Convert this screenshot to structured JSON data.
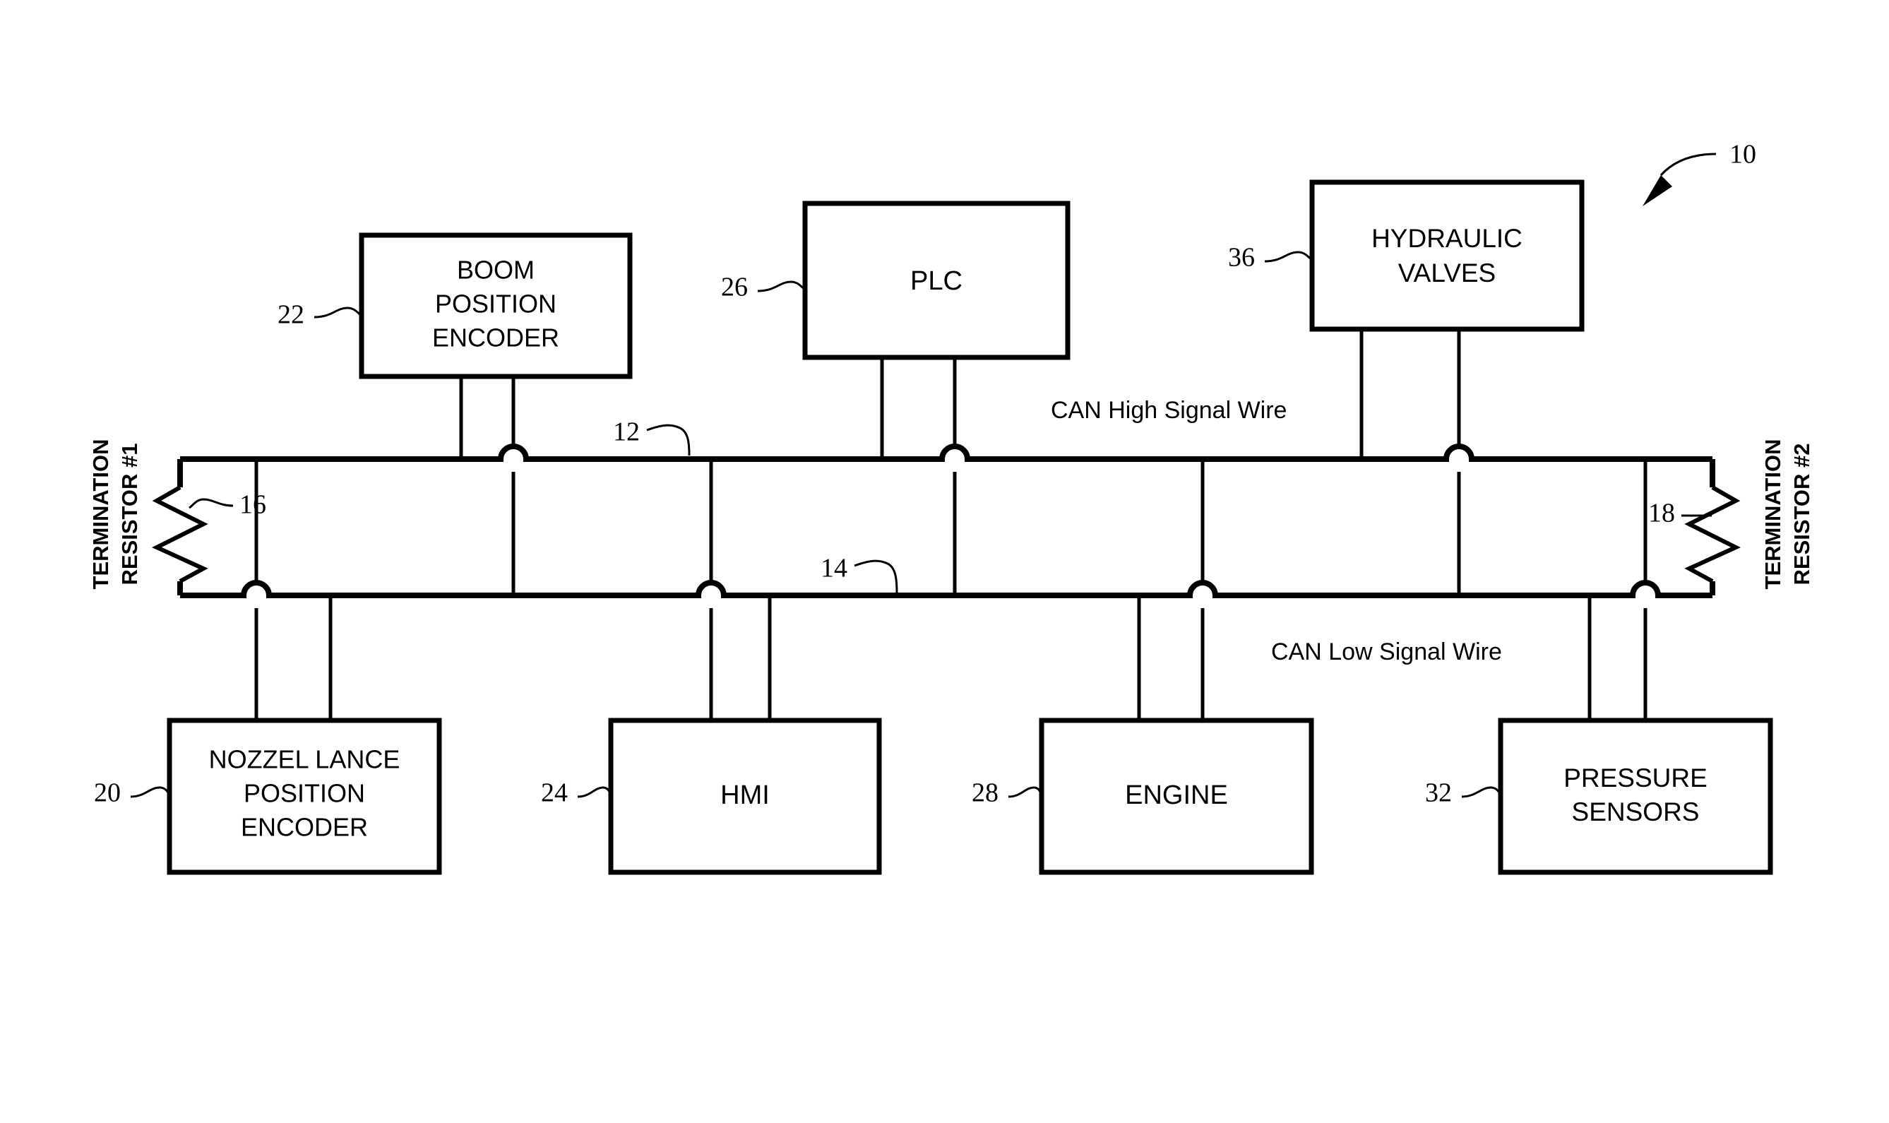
{
  "figure": {
    "ref_number": "10",
    "bus_lines": {
      "high": {
        "ref": "12",
        "label": "CAN High Signal Wire"
      },
      "low": {
        "ref": "14",
        "label": "CAN Low Signal Wire"
      }
    },
    "terminations": [
      {
        "ref": "16",
        "label_line1": "TERMINATION",
        "label_line2": "RESISTOR #1",
        "side": "left"
      },
      {
        "ref": "18",
        "label_line1": "TERMINATION",
        "label_line2": "RESISTOR #2",
        "side": "right"
      }
    ],
    "top_nodes": [
      {
        "ref": "22",
        "lines": [
          "BOOM",
          "POSITION",
          "ENCODER"
        ]
      },
      {
        "ref": "26",
        "lines": [
          "PLC"
        ]
      },
      {
        "ref": "36",
        "lines": [
          "HYDRAULIC",
          "VALVES"
        ]
      }
    ],
    "bottom_nodes": [
      {
        "ref": "20",
        "lines": [
          "NOZZEL LANCE",
          "POSITION",
          "ENCODER"
        ]
      },
      {
        "ref": "24",
        "lines": [
          "HMI"
        ]
      },
      {
        "ref": "28",
        "lines": [
          "ENGINE"
        ]
      },
      {
        "ref": "32",
        "lines": [
          "PRESSURE",
          "SENSORS"
        ]
      }
    ]
  }
}
